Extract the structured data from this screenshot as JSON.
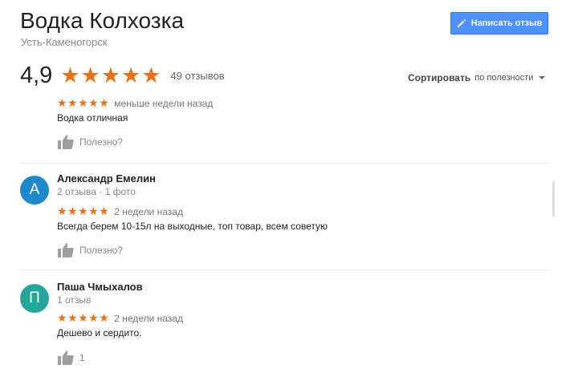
{
  "place": {
    "name": "Водка Колхозка",
    "city": "Усть-Каменогорск"
  },
  "write_review_button": {
    "label": "Написать отзыв",
    "icon": "pencil-icon"
  },
  "summary": {
    "rating": "4,9",
    "stars": 5,
    "review_count": "49 отзывов"
  },
  "sort": {
    "label": "Сортировать",
    "value": "по полезности"
  },
  "colors": {
    "star": "#e7711b",
    "button": "#4d90fe",
    "avatar_a": "#1e88c8",
    "avatar_p": "#26a69a"
  },
  "reviews": [
    {
      "author": "",
      "meta": "",
      "stars": "★★★★★",
      "time": "меньше недели назад",
      "text": "Водка отличная",
      "helpful": "Полезно?"
    },
    {
      "initial": "А",
      "author": "Александр Емелин",
      "meta": "2 отзыва · 1 фото",
      "stars": "★★★★★",
      "time": "2 недели назад",
      "text": "Всегда берем 10-15л на выходные, топ товар, всем советую",
      "helpful": "Полезно?"
    },
    {
      "initial": "П",
      "author": "Паша Чмыхалов",
      "meta": "1 отзыв",
      "stars": "★★★★★",
      "time": "2 недели назад",
      "text": "Дешево и сердито.",
      "helpful": "1"
    }
  ]
}
